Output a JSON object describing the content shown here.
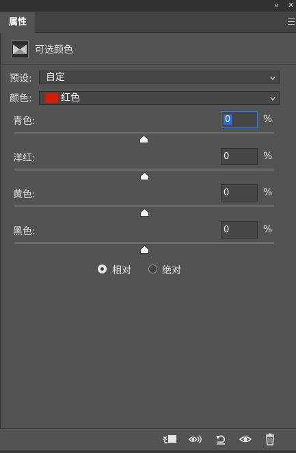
{
  "window": {
    "collapse_glyph": "«",
    "close_glyph": "✕"
  },
  "panel": {
    "tab_label": "属性"
  },
  "header": {
    "title": "可选颜色",
    "icon": "mask-icon"
  },
  "preset": {
    "label": "预设:",
    "value": "自定"
  },
  "color": {
    "label": "颜色:",
    "value": "红色",
    "swatch_color": "#d51d03"
  },
  "sliders": [
    {
      "label": "青色:",
      "value": "0",
      "unit": "%"
    },
    {
      "label": "洋红:",
      "value": "0",
      "unit": "%"
    },
    {
      "label": "黄色:",
      "value": "0",
      "unit": "%"
    },
    {
      "label": "黑色:",
      "value": "0",
      "unit": "%"
    }
  ],
  "method": {
    "relative_label": "相对",
    "absolute_label": "绝对",
    "selected": "relative"
  },
  "footer_icons": [
    "clip-to-layer-icon",
    "view-previous-state-icon",
    "reset-icon",
    "visibility-eye-icon",
    "trash-icon"
  ]
}
